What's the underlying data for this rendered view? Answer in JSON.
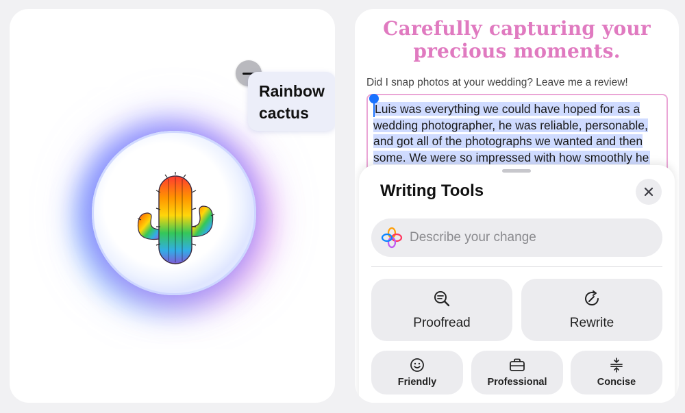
{
  "image_playground": {
    "concept_label_line1": "Rainbow",
    "concept_label_line2": "cactus",
    "remove_concept_icon": "minus-icon",
    "preview_icon": "rainbow-cactus-emoji"
  },
  "review_page": {
    "headline_line1": "Carefully capturing your",
    "headline_line2": "precious moments.",
    "prompt": "Did I snap photos at your wedding? Leave me a review!",
    "review_text": "Luis was everything we could have hoped for as a wedding photographer, he was reliable, personable, and got all of the photographs we wanted and then some. We were so impressed with how smoothly he",
    "headline_color": "#e07ac0",
    "selection_color": "#cfdbff",
    "caret_color": "#1a73ff"
  },
  "writing_tools": {
    "title": "Writing Tools",
    "close_icon": "close-icon",
    "search_placeholder": "Describe your change",
    "search_icon": "apple-intelligence-icon",
    "primary_actions": [
      {
        "label": "Proofread",
        "icon": "proofread-icon"
      },
      {
        "label": "Rewrite",
        "icon": "rewrite-icon"
      }
    ],
    "tone_actions": [
      {
        "label": "Friendly",
        "icon": "smiley-icon"
      },
      {
        "label": "Professional",
        "icon": "briefcase-icon"
      },
      {
        "label": "Concise",
        "icon": "concise-icon"
      }
    ]
  }
}
